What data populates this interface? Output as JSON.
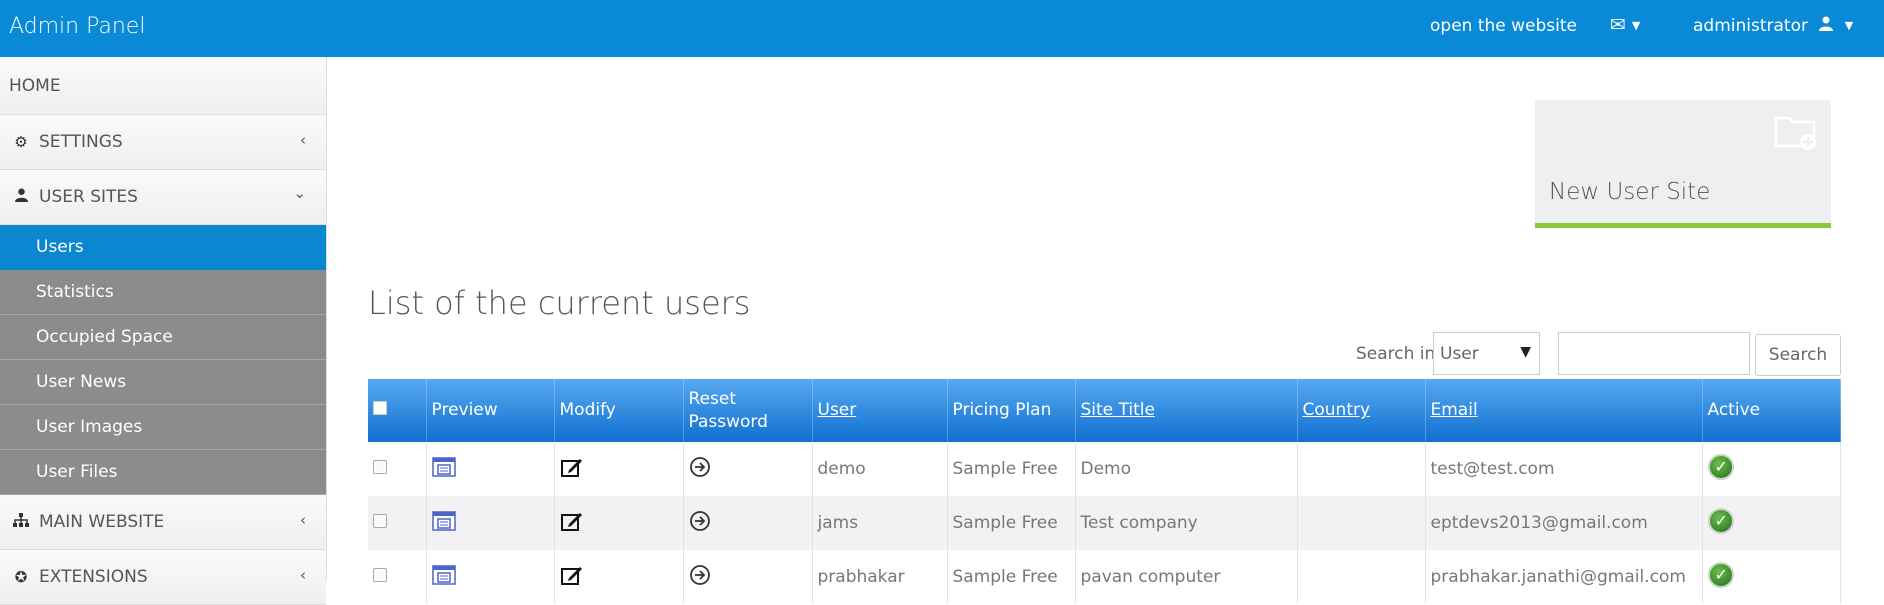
{
  "topbar": {
    "title": "Admin Panel",
    "open_website": "open the website",
    "user": "administrator"
  },
  "sidebar": {
    "home": "HOME",
    "sections": [
      {
        "label": "SETTINGS",
        "icon": "gears-icon"
      },
      {
        "label": "USER SITES",
        "icon": "user-icon"
      },
      {
        "label": "MAIN WEBSITE",
        "icon": "sitemap-icon"
      },
      {
        "label": "EXTENSIONS",
        "icon": "puzzle-icon"
      }
    ],
    "user_sites_items": [
      "Users",
      "Statistics",
      "Occupied Space",
      "User News",
      "User Images",
      "User Files"
    ]
  },
  "card": {
    "label": "New User Site",
    "icon": "folder-plus-icon"
  },
  "page_title": "List of the current users",
  "search": {
    "label": "Search in",
    "field": "User",
    "button": "Search",
    "value": ""
  },
  "table": {
    "headers": {
      "preview": "Preview",
      "modify": "Modify",
      "reset_line1": "Reset",
      "reset_line2": "Password",
      "user": "User",
      "plan": "Pricing Plan",
      "site": "Site Title",
      "country": "Country",
      "email": "Email",
      "active": "Active"
    },
    "rows": [
      {
        "user": "demo",
        "plan": "Sample Free",
        "site": "Demo",
        "country": "",
        "email": "test@test.com",
        "active": true
      },
      {
        "user": "jams",
        "plan": "Sample Free",
        "site": "Test company",
        "country": "",
        "email": "eptdevs2013@gmail.com",
        "active": true
      },
      {
        "user": "prabhakar",
        "plan": "Sample Free",
        "site": "pavan computer",
        "country": "",
        "email": "prabhakar.janathi@gmail.com",
        "active": true
      }
    ]
  },
  "colors": {
    "topbar": "#0a8ad6",
    "active_item": "#0a87cf",
    "card_accent": "#8dc63f"
  }
}
